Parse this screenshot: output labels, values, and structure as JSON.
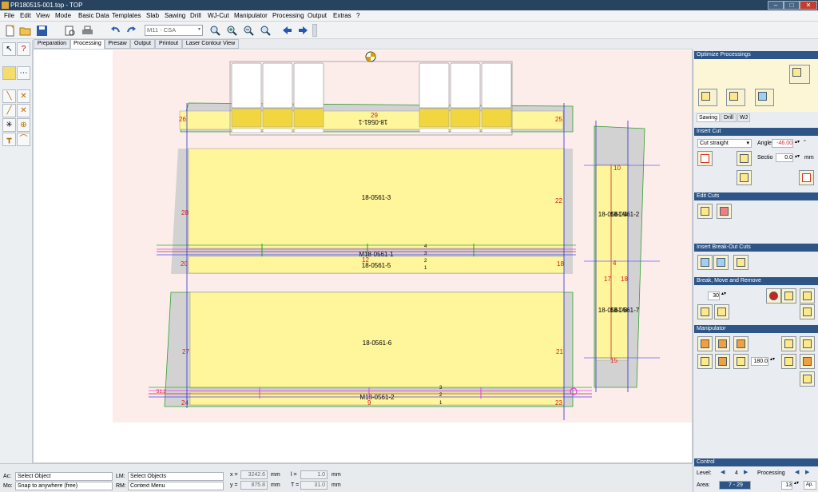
{
  "window": {
    "title": "PR180515-001.top - TOP",
    "min": "–",
    "max": "□",
    "close": "✕"
  },
  "menu": [
    "File",
    "Edit",
    "View",
    "Mode",
    "Basic Data",
    "Templates",
    "Slab",
    "Sawing",
    "Drill",
    "WJ-Cut",
    "Manipulator",
    "Processing",
    "Output",
    "Extras",
    "?"
  ],
  "toolbar": {
    "machine_select": "M11 - CSA"
  },
  "tabs": [
    "Preparation",
    "Processing",
    "Presaw",
    "Output",
    "Printout",
    "Laser Contour View"
  ],
  "active_tab": "Processing",
  "canvas": {
    "parts": [
      "18-0561-1",
      "18-0561-3",
      "M18-0561-1",
      "18-0561-5",
      "18-0561-6",
      "M18-0561-2",
      "18-0561-4",
      "18-0561-2",
      "18-0561-8",
      "18-0561-7"
    ],
    "edge_numbers": [
      "26",
      "29",
      "25",
      "28",
      "22",
      "20",
      "12",
      "18",
      "27",
      "21",
      "24",
      "9",
      "23",
      "10",
      "4",
      "17",
      "18",
      "15"
    ],
    "cut_labels": [
      "4",
      "3",
      "2",
      "1",
      "3",
      "2",
      "1"
    ],
    "dim_label": "51.2"
  },
  "right_panel": {
    "optimize_header": "Optimize Processings",
    "subtabs": [
      "Sawing",
      "Drill",
      "WJ"
    ],
    "active_subtab": "Sawing",
    "insert_cut_header": "Insert Cut",
    "cut_mode": "Cut straight",
    "angle_label": "Angle",
    "angle_value": "-46.00",
    "angle_unit": "°",
    "section_label": "Sectio",
    "section_value": "0.0",
    "section_unit": "mm",
    "edit_cuts_header": "Edit Cuts",
    "breakout_header": "Insert Break-Out Cuts",
    "break_move_header": "Break, Move and Remove",
    "break_value": "30",
    "manipulator_header": "Manipulator",
    "manip_value": "180.0",
    "control_header": "Control",
    "level_label": "Level:",
    "level_value": "4",
    "area_label": "Area:",
    "area_value": "7 - 29",
    "processing_label": "Processing",
    "processing_value": "13",
    "ap_label": "Ap."
  },
  "status": {
    "ac_label": "Ac:",
    "ac_value": "Select Object",
    "lm_label": "LM:",
    "lm_value": "Select Objects",
    "mo_label": "Mo:",
    "mo_value": "Snap to anywhere (free)",
    "rm_label": "RM:",
    "rm_value": "Context Menu",
    "x_label": "x =",
    "x_value": "3242.6",
    "y_label": "y =",
    "y_value": "875.8",
    "mm1": "mm",
    "mm2": "mm",
    "l_label": "l =",
    "l_value": "1.0",
    "t_label": "T =",
    "t_value": "31.0",
    "mm3": "mm",
    "mm4": "mm"
  }
}
